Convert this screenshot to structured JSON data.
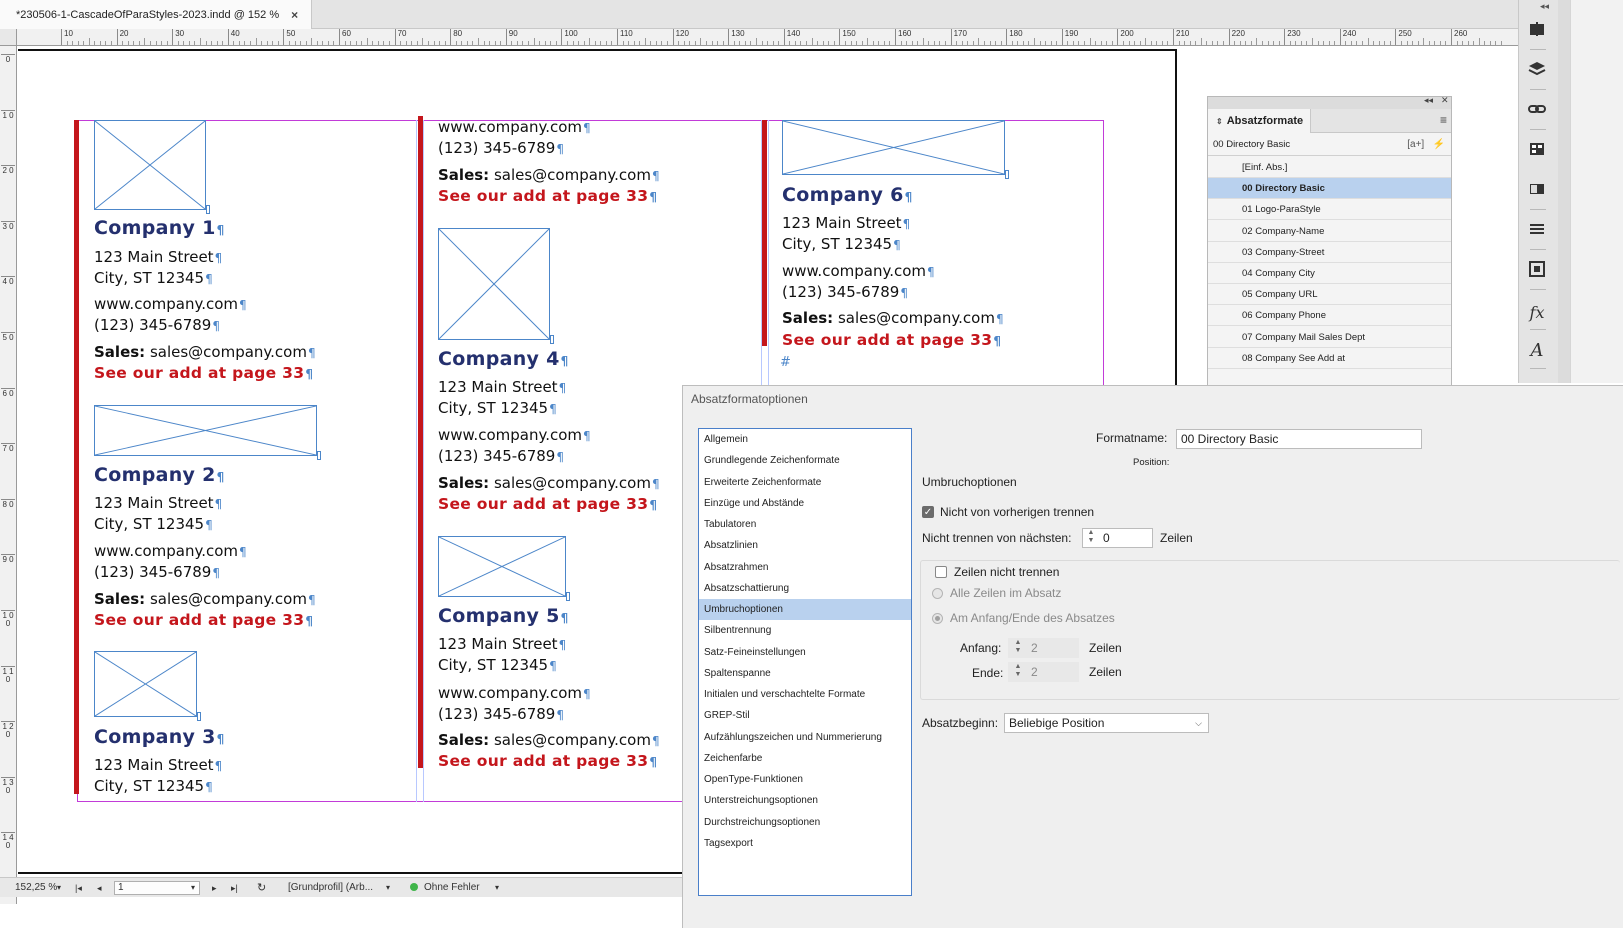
{
  "document": {
    "tab_title": "*230506-1-CascadeOfParaStyles-2023.indd @ 152 %",
    "close_glyph": "×"
  },
  "ruler": {
    "h_labels": [
      "10",
      "20",
      "30",
      "40",
      "50",
      "60",
      "70",
      "80",
      "90",
      "100",
      "110",
      "120",
      "130",
      "140",
      "150",
      "160",
      "170",
      "180",
      "190",
      "200",
      "210",
      "220",
      "230",
      "240",
      "250",
      "260"
    ],
    "v_labels": [
      "0",
      "1 0",
      "2 0",
      "3 0",
      "4 0",
      "5 0",
      "6 0",
      "7 0",
      "8 0",
      "9 0",
      "1 0 0",
      "1 1 0",
      "1 2 0",
      "1 3 0",
      "1 4 0"
    ]
  },
  "entries": [
    {
      "name": "Company 1",
      "street": "123 Main Street",
      "city": "City, ST 12345",
      "url": "www.company.com",
      "phone": "(123) 345-6789",
      "sales_label": "Sales:",
      "sales_email": "sales@company.com",
      "see": "See our add at page 33"
    },
    {
      "name": "Company 2",
      "street": "123 Main Street",
      "city": "City, ST 12345",
      "url": "www.company.com",
      "phone": "(123) 345-6789",
      "sales_label": "Sales:",
      "sales_email": "sales@company.com",
      "see": "See our add at page 33"
    },
    {
      "name": "Company 3",
      "street": "123 Main Street",
      "city": "City, ST 12345"
    },
    {
      "url": "www.company.com",
      "phone": "(123) 345-6789",
      "sales_label": "Sales:",
      "sales_email": "sales@company.com",
      "see": "See our add at page 33"
    },
    {
      "name": "Company 4",
      "street": "123 Main Street",
      "city": "City, ST 12345",
      "url": "www.company.com",
      "phone": "(123) 345-6789",
      "sales_label": "Sales:",
      "sales_email": "sales@company.com",
      "see": "See our add at page 33"
    },
    {
      "name": "Company 5",
      "street": "123 Main Street",
      "city": "City, ST 12345",
      "url": "www.company.com",
      "phone": "(123) 345-6789",
      "sales_label": "Sales:",
      "sales_email": "sales@company.com",
      "see": "See our add at page 33"
    },
    {
      "name": "Company 6",
      "street": "123 Main Street",
      "city": "City, ST 12345",
      "url": "www.company.com",
      "phone": "(123) 345-6789",
      "sales_label": "Sales:",
      "sales_email": "sales@company.com",
      "see": "See our add at page 33"
    }
  ],
  "end_of_story_marker": "#",
  "statusbar": {
    "zoom": "152,25 %",
    "page": "1",
    "profile": "[Grundprofil] (Arb...",
    "preflight": "Ohne Fehler"
  },
  "right_toolbar": {
    "icons": [
      "pages-icon",
      "layers-icon",
      "links-icon",
      "swatches-icon",
      "gradient-icon",
      "stroke-icon",
      "text-wrap-icon",
      "effects-icon",
      "character-styles-icon"
    ],
    "effects_glyph": "fx",
    "char_glyph": "A"
  },
  "para_styles_panel": {
    "title": "Absatzformate",
    "current": "00 Directory Basic",
    "new_style_glyph": "[a+]",
    "lightning_glyph": "⚡",
    "items": [
      "[Einf. Abs.]",
      "00 Directory Basic",
      "01 Logo-ParaStyle",
      "02 Company-Name",
      "03 Company-Street",
      "04 Company City",
      "05 Company URL",
      "06 Company Phone",
      "07 Company Mail Sales Dept",
      "08 Company See Add at"
    ],
    "selected_index": 1
  },
  "dialog": {
    "title": "Absatzformatoptionen",
    "categories": [
      "Allgemein",
      "Grundlegende Zeichenformate",
      "Erweiterte Zeichenformate",
      "Einzüge und Abstände",
      "Tabulatoren",
      "Absatzlinien",
      "Absatzrahmen",
      "Absatzschattierung",
      "Umbruchoptionen",
      "Silbentrennung",
      "Satz-Feineinstellungen",
      "Spaltenspanne",
      "Initialen und verschachtelte Formate",
      "GREP-Stil",
      "Aufzählungszeichen und Nummerierung",
      "Zeichenfarbe",
      "OpenType-Funktionen",
      "Unterstreichungsoptionen",
      "Durchstreichungsoptionen",
      "Tagsexport"
    ],
    "selected_category": "Umbruchoptionen",
    "formatname_label": "Formatname:",
    "formatname_value": "00 Directory Basic",
    "position_label": "Position:",
    "section_title": "Umbruchoptionen",
    "keep_with_previous": "Nicht von vorherigen trennen",
    "keep_with_next_label": "Nicht trennen von nächsten:",
    "keep_with_next_value": "0",
    "lines_unit": "Zeilen",
    "keep_lines_together": "Zeilen nicht trennen",
    "all_lines": "Alle Zeilen im Absatz",
    "start_end": "Am Anfang/Ende des Absatzes",
    "start_label": "Anfang:",
    "start_value": "2",
    "end_label": "Ende:",
    "end_value": "2",
    "start_para_label": "Absatzbeginn:",
    "start_para_value": "Beliebige Position"
  },
  "colors": {
    "accent_red": "#c4161c",
    "company_navy": "#24306e",
    "frame_blue": "#4c86c9",
    "margin_magenta": "#c23bd8",
    "selection_blue": "#b9d1ee"
  }
}
